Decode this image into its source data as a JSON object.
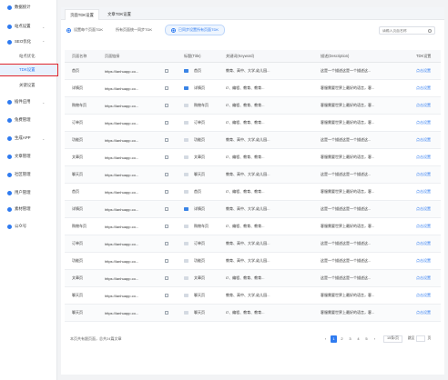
{
  "sidebar": {
    "items": [
      {
        "label": "数据统计",
        "chevron": ""
      },
      {
        "label": "站点设置",
        "chevron": "⌄"
      },
      {
        "label": "SEO优化",
        "chevron": "⌃"
      },
      {
        "label": "站点优化",
        "chevron": ""
      },
      {
        "label": "TDK设置",
        "chevron": ""
      },
      {
        "label": "关键设置",
        "chevron": ""
      },
      {
        "label": "插件应用",
        "chevron": "⌄"
      },
      {
        "label": "兔费管理",
        "chevron": ""
      },
      {
        "label": "生成APP",
        "chevron": "⌄"
      },
      {
        "label": "文章管理",
        "chevron": ""
      },
      {
        "label": "社区管理",
        "chevron": ""
      },
      {
        "label": "用户管理",
        "chevron": ""
      },
      {
        "label": "素材管理",
        "chevron": ""
      },
      {
        "label": "公众号",
        "chevron": ""
      }
    ]
  },
  "tabs": [
    {
      "label": "页面TDK设置"
    },
    {
      "label": "文章TDK设置"
    }
  ],
  "filters": [
    {
      "label": "设置每个页面TDK"
    },
    {
      "label": "所有页面统一同步TDK"
    },
    {
      "label": "已同步设置所有页面TDK"
    }
  ],
  "search": {
    "placeholder": "请输入页面名称"
  },
  "table": {
    "headers": {
      "name": "页面名称",
      "link": "页面链接",
      "title": "标题(Title)",
      "keywords": "关键词(Keyword)",
      "desc": "描述(Description)",
      "action": "TDK设置"
    },
    "rows": [
      {
        "name": "首页",
        "link": "https://lanhuapp.co...",
        "title": "首页",
        "keywords": "教育、高中、大学,幼儿园...",
        "desc": "这是一个描述这是一个描述这...",
        "action": "点击设置"
      },
      {
        "name": "详情页",
        "link": "https://lanhuapp.co...",
        "title": "详情页",
        "keywords": "l7、编程、教育、教育...",
        "desc": "客服需要世界上最好的语言，客...",
        "action": "点击设置"
      },
      {
        "name": "购物车页",
        "link": "https://lanhuapp.co...",
        "title": "购物车页",
        "keywords": "l7、编程、教育、教育...",
        "desc": "客服需要世界上最好的语言，客...",
        "action": "点击设置"
      },
      {
        "name": "订单页",
        "link": "https://lanhuapp.co...",
        "title": "订单页",
        "keywords": "l7、编程、教育、教育...",
        "desc": "客服需要世界上最好的语言，客...",
        "action": "点击设置"
      },
      {
        "name": "功能页",
        "link": "https://lanhuapp.co...",
        "title": "功能页",
        "keywords": "教育、高中、大学,幼儿园...",
        "desc": "这是一个描述这是一个描述这...",
        "action": "点击设置"
      },
      {
        "name": "文章页",
        "link": "https://lanhuapp.co...",
        "title": "文章页",
        "keywords": "l7、编程、教育、教育...",
        "desc": "客服需要世界上最好的语言，客...",
        "action": "点击设置"
      },
      {
        "name": "聊天页",
        "link": "https://lanhuapp.co...",
        "title": "聊天页",
        "keywords": "教育、高中、大学,幼儿园...",
        "desc": "这是一个描述这是一个描述这...",
        "action": "点击设置"
      },
      {
        "name": "首页",
        "link": "https://lanhuapp.co...",
        "title": "首页",
        "keywords": "l7、编程、教育、教育...",
        "desc": "客服需要世界上最好的语言，客...",
        "action": "点击设置"
      },
      {
        "name": "详情页",
        "link": "https://lanhuapp.co...",
        "title": "详情页",
        "keywords": "教育、高中、大学,幼儿园...",
        "desc": "这是一个描述这是一个描述这...",
        "action": "点击设置"
      },
      {
        "name": "购物车页",
        "link": "https://lanhuapp.co...",
        "title": "购物车页",
        "keywords": "l7、编程、教育、教育...",
        "desc": "客服需要世界上最好的语言，客...",
        "action": "点击设置"
      },
      {
        "name": "订单页",
        "link": "https://lanhuapp.co...",
        "title": "订单页",
        "keywords": "教育、高中、大学,幼儿园...",
        "desc": "这是一个描述这是一个描述这...",
        "action": "点击设置"
      },
      {
        "name": "功能页",
        "link": "https://lanhuapp.co...",
        "title": "功能页",
        "keywords": "教育、高中、大学,幼儿园...",
        "desc": "这是一个描述这是一个描述这...",
        "action": "点击设置"
      },
      {
        "name": "文章页",
        "link": "https://lanhuapp.co...",
        "title": "文章页",
        "keywords": "l7、编程、教育、教育...",
        "desc": "这是一个描述这是一个描述这...",
        "action": "点击设置"
      },
      {
        "name": "聊天页",
        "link": "https://lanhuapp.co...",
        "title": "聊天页",
        "keywords": "教育、高中、大学,幼儿园...",
        "desc": "客服需要世界上最好的语言，客...",
        "action": "点击设置"
      },
      {
        "name": "聊天页",
        "link": "https://lanhuapp.co...",
        "title": "聊天页",
        "keywords": "l7、编程、教育、教育...",
        "desc": "客服需要世界上最好的语言，客...",
        "action": "点击设置"
      }
    ]
  },
  "footer": {
    "summary": "本页共有跟页面，总共24篇文章"
  },
  "pagination": {
    "prev": "‹",
    "pages": [
      "1",
      "2",
      "3",
      "4",
      "5"
    ],
    "next": "›",
    "page_size": "15条/页",
    "jump_prefix": "跳至",
    "jump_suffix": "页"
  },
  "colors": {
    "accent": "#2f7bf0",
    "highlight_border": "#e0242b"
  }
}
